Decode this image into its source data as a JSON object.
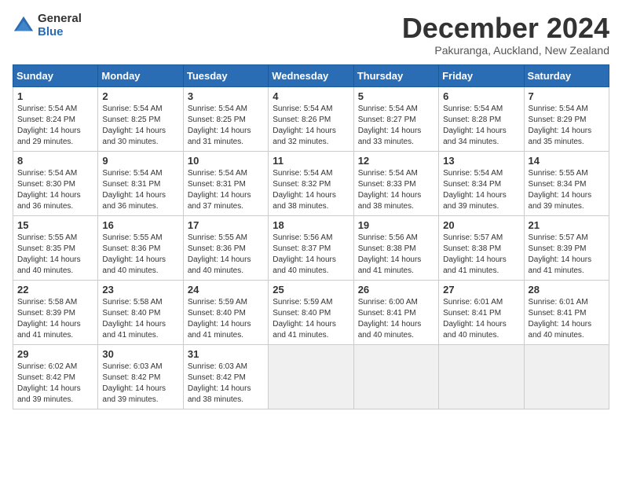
{
  "header": {
    "logo_general": "General",
    "logo_blue": "Blue",
    "month_title": "December 2024",
    "subtitle": "Pakuranga, Auckland, New Zealand"
  },
  "weekdays": [
    "Sunday",
    "Monday",
    "Tuesday",
    "Wednesday",
    "Thursday",
    "Friday",
    "Saturday"
  ],
  "weeks": [
    [
      {
        "day": "1",
        "sunrise": "5:54 AM",
        "sunset": "8:24 PM",
        "daylight": "14 hours and 29 minutes."
      },
      {
        "day": "2",
        "sunrise": "5:54 AM",
        "sunset": "8:25 PM",
        "daylight": "14 hours and 30 minutes."
      },
      {
        "day": "3",
        "sunrise": "5:54 AM",
        "sunset": "8:25 PM",
        "daylight": "14 hours and 31 minutes."
      },
      {
        "day": "4",
        "sunrise": "5:54 AM",
        "sunset": "8:26 PM",
        "daylight": "14 hours and 32 minutes."
      },
      {
        "day": "5",
        "sunrise": "5:54 AM",
        "sunset": "8:27 PM",
        "daylight": "14 hours and 33 minutes."
      },
      {
        "day": "6",
        "sunrise": "5:54 AM",
        "sunset": "8:28 PM",
        "daylight": "14 hours and 34 minutes."
      },
      {
        "day": "7",
        "sunrise": "5:54 AM",
        "sunset": "8:29 PM",
        "daylight": "14 hours and 35 minutes."
      }
    ],
    [
      {
        "day": "8",
        "sunrise": "5:54 AM",
        "sunset": "8:30 PM",
        "daylight": "14 hours and 36 minutes."
      },
      {
        "day": "9",
        "sunrise": "5:54 AM",
        "sunset": "8:31 PM",
        "daylight": "14 hours and 36 minutes."
      },
      {
        "day": "10",
        "sunrise": "5:54 AM",
        "sunset": "8:31 PM",
        "daylight": "14 hours and 37 minutes."
      },
      {
        "day": "11",
        "sunrise": "5:54 AM",
        "sunset": "8:32 PM",
        "daylight": "14 hours and 38 minutes."
      },
      {
        "day": "12",
        "sunrise": "5:54 AM",
        "sunset": "8:33 PM",
        "daylight": "14 hours and 38 minutes."
      },
      {
        "day": "13",
        "sunrise": "5:54 AM",
        "sunset": "8:34 PM",
        "daylight": "14 hours and 39 minutes."
      },
      {
        "day": "14",
        "sunrise": "5:55 AM",
        "sunset": "8:34 PM",
        "daylight": "14 hours and 39 minutes."
      }
    ],
    [
      {
        "day": "15",
        "sunrise": "5:55 AM",
        "sunset": "8:35 PM",
        "daylight": "14 hours and 40 minutes."
      },
      {
        "day": "16",
        "sunrise": "5:55 AM",
        "sunset": "8:36 PM",
        "daylight": "14 hours and 40 minutes."
      },
      {
        "day": "17",
        "sunrise": "5:55 AM",
        "sunset": "8:36 PM",
        "daylight": "14 hours and 40 minutes."
      },
      {
        "day": "18",
        "sunrise": "5:56 AM",
        "sunset": "8:37 PM",
        "daylight": "14 hours and 40 minutes."
      },
      {
        "day": "19",
        "sunrise": "5:56 AM",
        "sunset": "8:38 PM",
        "daylight": "14 hours and 41 minutes."
      },
      {
        "day": "20",
        "sunrise": "5:57 AM",
        "sunset": "8:38 PM",
        "daylight": "14 hours and 41 minutes."
      },
      {
        "day": "21",
        "sunrise": "5:57 AM",
        "sunset": "8:39 PM",
        "daylight": "14 hours and 41 minutes."
      }
    ],
    [
      {
        "day": "22",
        "sunrise": "5:58 AM",
        "sunset": "8:39 PM",
        "daylight": "14 hours and 41 minutes."
      },
      {
        "day": "23",
        "sunrise": "5:58 AM",
        "sunset": "8:40 PM",
        "daylight": "14 hours and 41 minutes."
      },
      {
        "day": "24",
        "sunrise": "5:59 AM",
        "sunset": "8:40 PM",
        "daylight": "14 hours and 41 minutes."
      },
      {
        "day": "25",
        "sunrise": "5:59 AM",
        "sunset": "8:40 PM",
        "daylight": "14 hours and 41 minutes."
      },
      {
        "day": "26",
        "sunrise": "6:00 AM",
        "sunset": "8:41 PM",
        "daylight": "14 hours and 40 minutes."
      },
      {
        "day": "27",
        "sunrise": "6:01 AM",
        "sunset": "8:41 PM",
        "daylight": "14 hours and 40 minutes."
      },
      {
        "day": "28",
        "sunrise": "6:01 AM",
        "sunset": "8:41 PM",
        "daylight": "14 hours and 40 minutes."
      }
    ],
    [
      {
        "day": "29",
        "sunrise": "6:02 AM",
        "sunset": "8:42 PM",
        "daylight": "14 hours and 39 minutes."
      },
      {
        "day": "30",
        "sunrise": "6:03 AM",
        "sunset": "8:42 PM",
        "daylight": "14 hours and 39 minutes."
      },
      {
        "day": "31",
        "sunrise": "6:03 AM",
        "sunset": "8:42 PM",
        "daylight": "14 hours and 38 minutes."
      },
      null,
      null,
      null,
      null
    ]
  ]
}
